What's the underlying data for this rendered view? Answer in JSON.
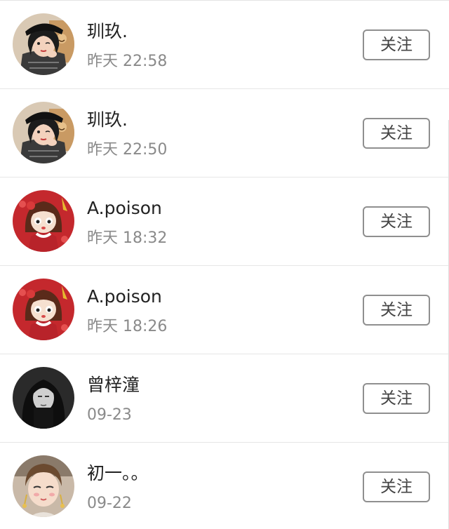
{
  "follow_list": {
    "items": [
      {
        "name": "玔玖.",
        "time": "昨天 22:58",
        "button_label": "关注",
        "avatar": "avatar-girl-black-hat-icon"
      },
      {
        "name": "玔玖.",
        "time": "昨天 22:50",
        "button_label": "关注",
        "avatar": "avatar-girl-black-hat-icon"
      },
      {
        "name": "A.poison",
        "time": "昨天 18:32",
        "button_label": "关注",
        "avatar": "avatar-cartoon-girl-icon"
      },
      {
        "name": "A.poison",
        "time": "昨天 18:26",
        "button_label": "关注",
        "avatar": "avatar-cartoon-girl-icon"
      },
      {
        "name": "曾梓潼",
        "time": "09-23",
        "button_label": "关注",
        "avatar": "avatar-dark-hair-girl-icon"
      },
      {
        "name": "初一。。",
        "time": "09-22",
        "button_label": "关注",
        "avatar": "avatar-girl-earrings-icon"
      }
    ]
  },
  "colors": {
    "name_text": "#222222",
    "time_text": "#8a8a8a",
    "button_border": "#8f8f8f",
    "divider": "#e6e6e6"
  }
}
